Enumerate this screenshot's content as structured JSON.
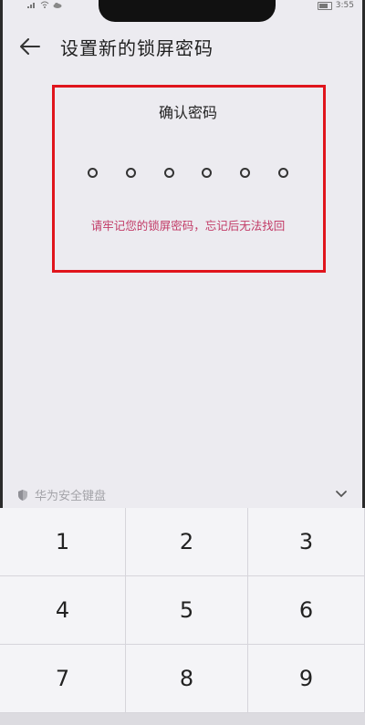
{
  "status": {
    "time": "3:55"
  },
  "header": {
    "title": "设置新的锁屏密码"
  },
  "confirm": {
    "title": "确认密码",
    "dots": 6,
    "warning": "请牢记您的锁屏密码，忘记后无法找回"
  },
  "keyboard": {
    "brand": "华为安全键盘",
    "keys": [
      "1",
      "2",
      "3",
      "4",
      "5",
      "6",
      "7",
      "8",
      "9"
    ]
  },
  "colors": {
    "highlight_border": "#e0141c",
    "warning_text": "#c23a66",
    "background": "#ecebf0"
  }
}
